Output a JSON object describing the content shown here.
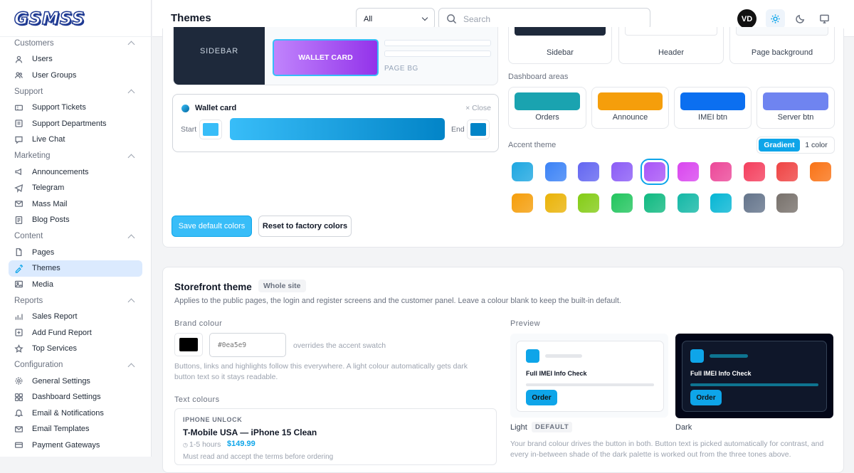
{
  "app": {
    "logo": "GSMSS",
    "page_title": "Themes"
  },
  "topbar": {
    "filter_value": "All",
    "search_placeholder": "Search",
    "avatar_initials": "VD"
  },
  "sidebar": {
    "sections": [
      {
        "label": "Customers",
        "items": [
          "Users",
          "User Groups"
        ]
      },
      {
        "label": "Support",
        "items": [
          "Support Tickets",
          "Support Departments",
          "Live Chat"
        ]
      },
      {
        "label": "Marketing",
        "items": [
          "Announcements",
          "Telegram",
          "Mass Mail",
          "Blog Posts"
        ]
      },
      {
        "label": "Content",
        "items": [
          "Pages",
          "Themes",
          "Media"
        ]
      },
      {
        "label": "Reports",
        "items": [
          "Sales Report",
          "Add Fund Report",
          "Top Services"
        ]
      },
      {
        "label": "Configuration",
        "items": [
          "General Settings",
          "Dashboard Settings",
          "Email & Notifications",
          "Email Templates",
          "Payment Gateways"
        ]
      }
    ],
    "active": "Themes"
  },
  "dashboard_theme": {
    "preview_sidebar": "SIDEBAR",
    "preview_wallet": "WALLET CARD",
    "preview_page_bg": "PAGE BG",
    "editor_title": "Wallet card",
    "close_label": "× Close",
    "start_label": "Start",
    "end_label": "End",
    "start_color": "#38bdf8",
    "end_color": "#0284c7",
    "top_swatches": [
      "Sidebar",
      "Header",
      "Page background"
    ],
    "dashboard_areas_label": "Dashboard areas",
    "area_swatches": [
      {
        "label": "Orders",
        "color": "#1aa3b0"
      },
      {
        "label": "Announce",
        "color": "#f59e0b"
      },
      {
        "label": "IMEI btn",
        "color": "#0b6ff0"
      },
      {
        "label": "Server btn",
        "color": "#6f84f0"
      }
    ],
    "accent_label": "Accent theme",
    "accent_modes": [
      "Gradient",
      "1 color"
    ],
    "accent_swatches": [
      "#1ea7e1",
      "#3b82f6",
      "#6366f1",
      "#8b5cf6",
      "#a855f7",
      "#d946ef",
      "#ec4899",
      "#f43f5e",
      "#ef4444",
      "#f97316",
      "#f59e0b",
      "#eab308",
      "#84cc16",
      "#22c55e",
      "#10b981",
      "#14b8a6",
      "#06b6d4",
      "#64748b",
      "#78716c"
    ],
    "save_button": "Save default colors",
    "reset_button": "Reset to factory colors"
  },
  "storefront": {
    "title": "Storefront theme",
    "badge": "Whole site",
    "description": "Applies to the public pages, the login and register screens and the customer panel. Leave a colour blank to keep the built-in default.",
    "brand_label": "Brand colour",
    "brand_swatch": "#000000",
    "brand_input_placeholder": "#0ea5e9",
    "brand_hint": "overrides the accent swatch",
    "brand_help": "Buttons, links and highlights follow this everywhere. A light colour automatically gets dark button text so it stays readable.",
    "text_colours_label": "Text colours",
    "sample_category": "IPHONE UNLOCK",
    "sample_title": "T-Mobile USA — iPhone 15 Clean",
    "sample_time": "1-5 hours",
    "sample_price": "$149.99",
    "sample_note": "Must read and accept the terms before ordering",
    "preview_label": "Preview",
    "preview_card_title": "Full IMEI Info Check",
    "preview_button": "Order",
    "light_label": "Light",
    "default_badge": "DEFAULT",
    "dark_label": "Dark",
    "preview_note": "Your brand colour drives the button in both. Button text is picked automatically for contrast, and every in-between shade of the dark palette is worked out from the three tones above."
  }
}
